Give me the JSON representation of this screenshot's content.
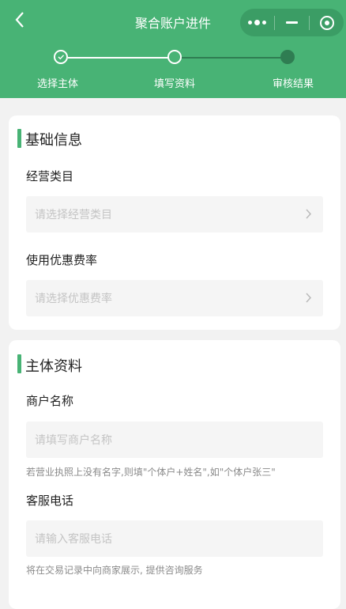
{
  "header": {
    "title": "聚合账户进件",
    "accent": "#48b375"
  },
  "steps": [
    {
      "label": "选择主体",
      "state": "done"
    },
    {
      "label": "填写资料",
      "state": "current"
    },
    {
      "label": "审核结果",
      "state": "pending"
    }
  ],
  "basic_info": {
    "section_title": "基础信息",
    "category_label": "经营类目",
    "category_placeholder": "请选择经营类目",
    "rate_label": "使用优惠费率",
    "rate_placeholder": "请选择优惠费率"
  },
  "entity_info": {
    "section_title": "主体资料",
    "merchant_name_label": "商户名称",
    "merchant_name_placeholder": "请填写商户名称",
    "merchant_name_hint": "若营业执照上没有名字,则填\"个体户+姓名\",如\"个体户张三\"",
    "phone_label": "客服电话",
    "phone_placeholder": "请输入客服电话",
    "phone_hint": "将在交易记录中向商家展示, 提供咨询服务"
  }
}
